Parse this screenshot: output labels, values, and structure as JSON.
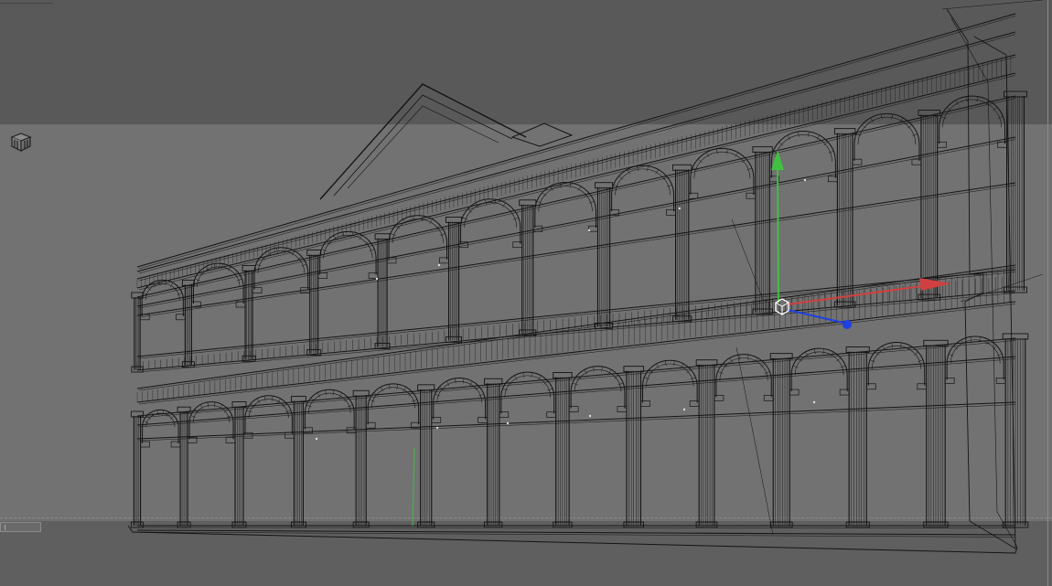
{
  "viewport": {
    "colors": {
      "background_top": "#595959",
      "background_middle": "#727272",
      "background_bottom": "#5f5f5f",
      "wireframe": "#141414",
      "gizmo_x_axis": "#d04040",
      "gizmo_y_axis": "#40c040",
      "gizmo_z_axis": "#2040e0",
      "gizmo_pivot": "#ffffff"
    },
    "icons": [
      "view-cube-icon",
      "transform-gizmo",
      "scroll-handle-icon"
    ],
    "model": {
      "upper_arcade_bays": 12,
      "lower_arcade_bays": 13,
      "has_pediment": true
    }
  }
}
